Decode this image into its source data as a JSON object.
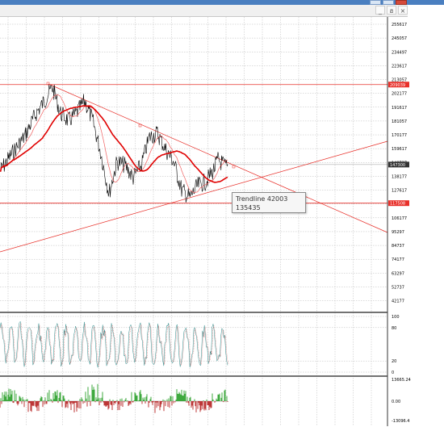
{
  "window": {
    "minimize_glyph": "_",
    "restore_glyph": "ฮ",
    "close_glyph": "×"
  },
  "price_axis": {
    "labels": [
      "255617",
      "245057",
      "234497",
      "223617",
      "213057",
      "202177",
      "191617",
      "181057",
      "170177",
      "159617",
      "148737",
      "138177",
      "127617",
      "116737",
      "106177",
      "95297",
      "84737",
      "74177",
      "63297",
      "52737",
      "42177"
    ]
  },
  "price_tags": {
    "upper_level": {
      "label": "209039",
      "color": "#e8302a"
    },
    "current": {
      "label": "147300",
      "color": "#333333"
    },
    "lower_level": {
      "label": "117508",
      "color": "#e8302a"
    }
  },
  "oscillator_axis": {
    "labels": [
      "100",
      "80",
      "20",
      "0"
    ]
  },
  "histogram_axis": {
    "labels": [
      "13665.24",
      "0.00",
      "-13096.4"
    ]
  },
  "tooltip": {
    "line1": "Trendline 42003",
    "line2": "135435"
  },
  "colors": {
    "price_line": "#000000",
    "ma_fast": "#f06060",
    "ma_slow": "#e00000",
    "hline": "#e8302a",
    "trend": "#e8302a",
    "grid": "#b8b8b8",
    "osc": "#2a8a8a",
    "hist_pos": "#2aa02a",
    "hist_neg": "#b52020"
  }
}
